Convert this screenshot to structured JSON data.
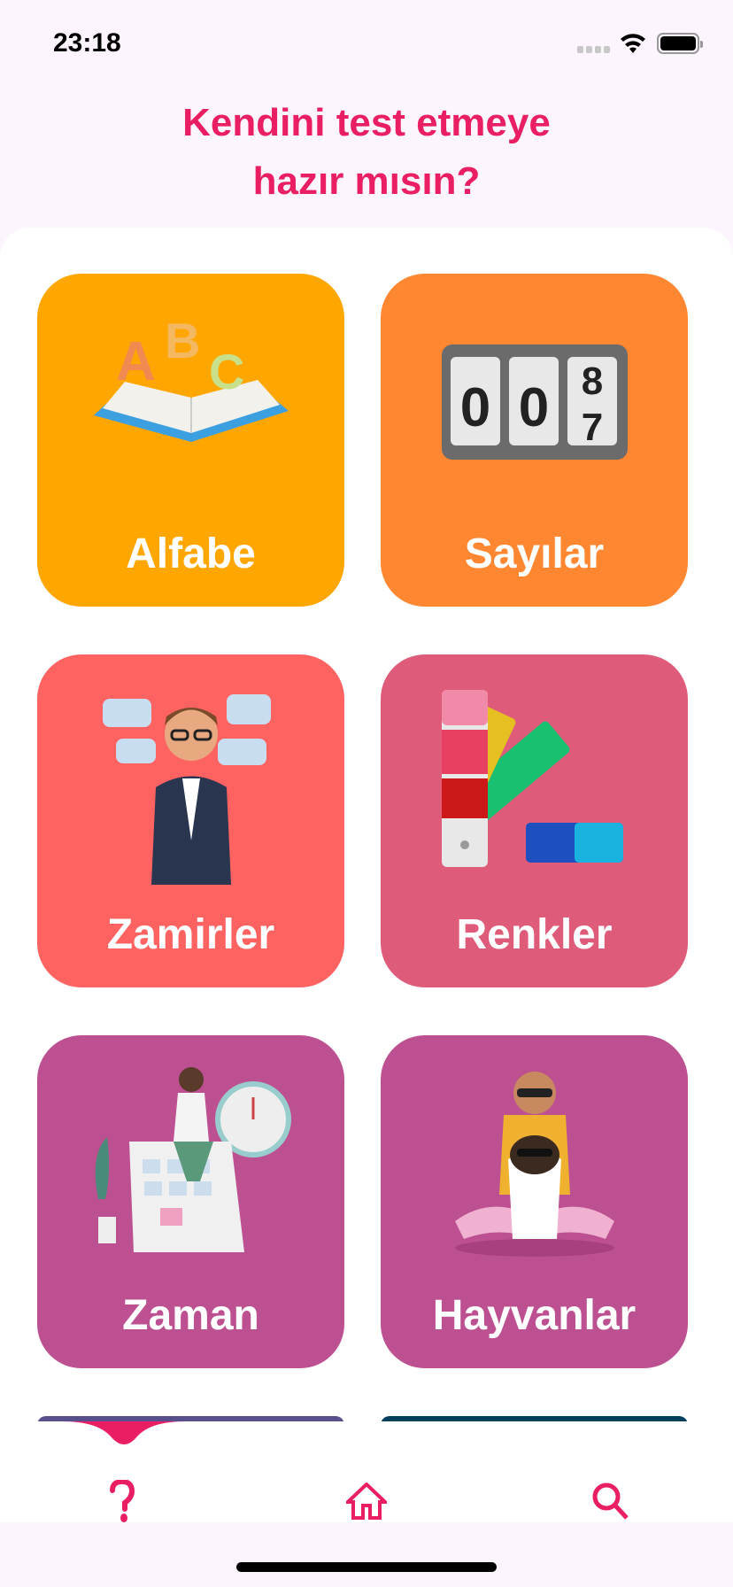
{
  "status_bar": {
    "time": "23:18"
  },
  "header": {
    "title_line1": "Kendini test etmeye",
    "title_line2": "hazır mısın?"
  },
  "categories": [
    {
      "label": "Alfabe",
      "color": "#ffa600",
      "icon": "abc-book-icon"
    },
    {
      "label": "Sayılar",
      "color": "#ff8731",
      "icon": "number-counter-icon"
    },
    {
      "label": "Zamirler",
      "color": "#ff6361",
      "icon": "thinking-person-icon"
    },
    {
      "label": "Renkler",
      "color": "#de5c7a",
      "icon": "color-palette-icon"
    },
    {
      "label": "Zaman",
      "color": "#bc5090",
      "icon": "calendar-clock-icon"
    },
    {
      "label": "Hayvanlar",
      "color": "#bc5090",
      "icon": "person-with-dog-icon"
    }
  ],
  "counter_digits": [
    "0",
    "0",
    "8",
    "7"
  ],
  "accent_color": "#e91e63",
  "tab_bar": {
    "items": [
      "question-icon",
      "home-icon",
      "search-icon"
    ],
    "active": "question-icon"
  }
}
